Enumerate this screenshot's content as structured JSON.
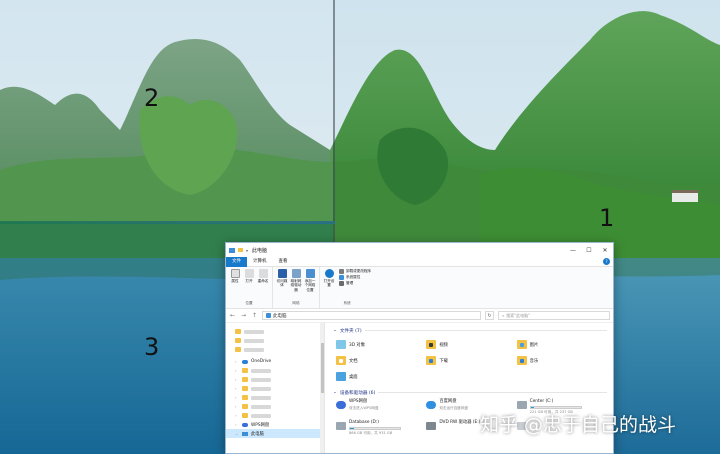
{
  "zones": [
    {
      "number": "1"
    },
    {
      "number": "2"
    },
    {
      "number": "3"
    }
  ],
  "watermark": "知乎 @忠于自己的战斗",
  "window": {
    "title": "此电脑",
    "controls": [
      "—",
      "☐",
      "✕"
    ],
    "tabs": [
      "文件",
      "计算机",
      "查看"
    ],
    "help": "?",
    "ribbon": {
      "location_group": {
        "name": "位置",
        "buttons": [
          "属性",
          "打开",
          "重命名"
        ]
      },
      "network_group": {
        "name": "网络",
        "buttons": [
          "访问媒体",
          "映射网络驱动器",
          "添加一个网络位置"
        ]
      },
      "system_group": {
        "name": "系统",
        "big_button": "打开设置",
        "small_buttons": [
          "卸载或更改程序",
          "系统属性",
          "管理"
        ]
      }
    },
    "address": {
      "back": "←",
      "forward": "→",
      "up": "↑",
      "path": "此电脑",
      "refresh": "↻",
      "search_placeholder": "搜索\"此电脑\""
    },
    "nav_pane": {
      "onedrive": "OneDrive",
      "wps": "WPS网盘",
      "this_pc": "此电脑"
    },
    "folders_section": {
      "title": "文件夹 (7)",
      "items": [
        "3D 对象",
        "视频",
        "图片",
        "文档",
        "下载",
        "音乐",
        "桌面"
      ]
    },
    "drives_section": {
      "title": "设备和驱动器 (6)",
      "items": [
        {
          "name": "WPS网盘",
          "sub": "双击进入WPS网盘",
          "fill": 0
        },
        {
          "name": "百度网盘",
          "sub": "双击运行百度网盘",
          "fill": 0
        },
        {
          "name": "Center (C:)",
          "sub": "221 GB 可用，共 237 GB",
          "fill": 0.07
        },
        {
          "name": "Database (D:)",
          "sub": "866 GB 可用，共 931 GB",
          "fill": 0.07
        },
        {
          "name": "DVD RW 驱动器 (E:)",
          "sub": "",
          "fill": 0
        },
        {
          "name": "",
          "sub": "",
          "fill": 0
        }
      ]
    }
  }
}
